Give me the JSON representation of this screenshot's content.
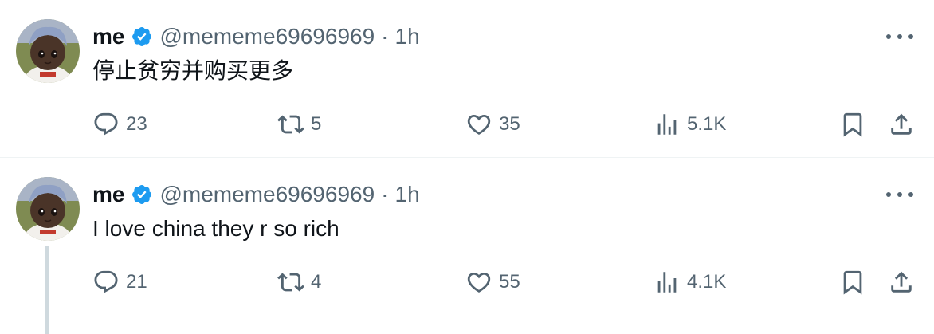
{
  "tweets": [
    {
      "author_name": "me",
      "author_handle": "@mememe69696969",
      "separator": "·",
      "time": "1h",
      "text": "停止贫穷并购买更多",
      "replies": "23",
      "retweets": "5",
      "likes": "35",
      "views": "5.1K"
    },
    {
      "author_name": "me",
      "author_handle": "@mememe69696969",
      "separator": "·",
      "time": "1h",
      "text": "I love china they r so rich",
      "replies": "21",
      "retweets": "4",
      "likes": "55",
      "views": "4.1K"
    }
  ],
  "colors": {
    "text": "#0f1419",
    "secondary": "#536471",
    "verified_blue": "#1d9bf0",
    "divider": "#eff3f4",
    "thread_line": "#cfd9de"
  },
  "icons": [
    "verified-badge-icon",
    "more-icon",
    "reply-icon",
    "retweet-icon",
    "like-icon",
    "views-icon",
    "bookmark-icon",
    "share-icon"
  ]
}
